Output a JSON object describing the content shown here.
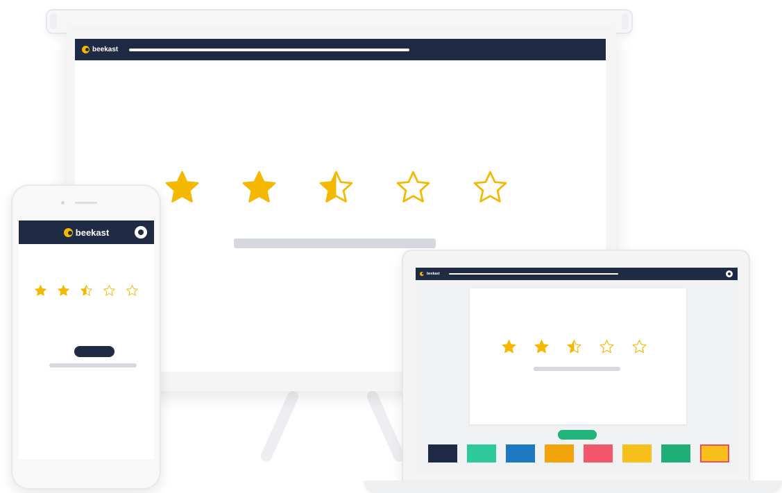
{
  "brand": {
    "name": "beekast",
    "navy": "#1f2b45",
    "yellow": "#f5b800",
    "placeholder_gray": "#d5d9df"
  },
  "rating": {
    "value": 2.5,
    "max": 5,
    "stars": [
      "full",
      "full",
      "half",
      "empty",
      "empty"
    ]
  },
  "projector": {
    "logo_text": "beekast"
  },
  "phone": {
    "logo_text": "beekast",
    "profile_icon": "user-circle-icon"
  },
  "laptop": {
    "logo_text": "beekast",
    "profile_icon": "user-circle-icon",
    "swatches": [
      {
        "color": "#1f2b45",
        "selected": false
      },
      {
        "color": "#2ec99a",
        "selected": false
      },
      {
        "color": "#1d78c1",
        "selected": false
      },
      {
        "color": "#f2a50b",
        "selected": false
      },
      {
        "color": "#f2566a",
        "selected": false
      },
      {
        "color": "#f7c01a",
        "selected": false
      },
      {
        "color": "#1eae76",
        "selected": false
      },
      {
        "color": "#f7c01a",
        "selected": true
      }
    ]
  }
}
